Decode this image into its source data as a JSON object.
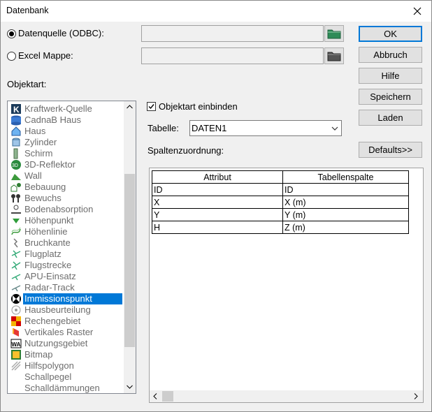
{
  "window": {
    "title": "Datenbank",
    "close_glyph": "✕"
  },
  "source": {
    "odbc_label": "Datenquelle (ODBC):",
    "odbc_value": "",
    "excel_label": "Excel Mappe:",
    "excel_value": ""
  },
  "object_type_label": "Objektart:",
  "object_types": [
    {
      "label": "Kraftwerk-Quelle",
      "icon": "power-plant-icon"
    },
    {
      "label": "CadnaB Haus",
      "icon": "house-db-icon"
    },
    {
      "label": "Haus",
      "icon": "house-icon"
    },
    {
      "label": "Zylinder",
      "icon": "cylinder-icon"
    },
    {
      "label": "Schirm",
      "icon": "screen-icon"
    },
    {
      "label": "3D-Reflektor",
      "icon": "3d-reflector-icon"
    },
    {
      "label": "Wall",
      "icon": "wall-icon"
    },
    {
      "label": "Bebauung",
      "icon": "buildings-icon"
    },
    {
      "label": "Bewuchs",
      "icon": "vegetation-icon"
    },
    {
      "label": "Bodenabsorption",
      "icon": "ground-absorption-icon"
    },
    {
      "label": "Höhenpunkt",
      "icon": "height-point-icon"
    },
    {
      "label": "Höhenlinie",
      "icon": "contour-line-icon"
    },
    {
      "label": "Bruchkante",
      "icon": "break-line-icon"
    },
    {
      "label": "Flugplatz",
      "icon": "airfield-icon"
    },
    {
      "label": "Flugstrecke",
      "icon": "flight-route-icon"
    },
    {
      "label": "APU-Einsatz",
      "icon": "apu-icon"
    },
    {
      "label": "Radar-Track",
      "icon": "radar-track-icon"
    },
    {
      "label": "Immissionspunkt",
      "icon": "receiver-point-icon",
      "selected": true
    },
    {
      "label": "Hausbeurteilung",
      "icon": "house-assessment-icon"
    },
    {
      "label": "Rechengebiet",
      "icon": "calc-area-icon"
    },
    {
      "label": "Vertikales Raster",
      "icon": "vertical-grid-icon"
    },
    {
      "label": "Nutzungsgebiet",
      "icon": "land-use-icon"
    },
    {
      "label": "Bitmap",
      "icon": "bitmap-icon"
    },
    {
      "label": "Hilfspolygon",
      "icon": "aux-polygon-icon"
    },
    {
      "label": "Schallpegel",
      "icon": ""
    },
    {
      "label": "Schalldämmungen",
      "icon": ""
    }
  ],
  "include_checkbox_label": "Objektart einbinden",
  "include_checked": true,
  "table_label": "Tabelle:",
  "table_value": "DATEN1",
  "column_mapping_label": "Spaltenzuordnung:",
  "buttons": {
    "ok": "OK",
    "cancel": "Abbruch",
    "help": "Hilfe",
    "save": "Speichern",
    "load": "Laden",
    "defaults": "Defaults>>"
  },
  "grid": {
    "headers": [
      "Attribut",
      "Tabellenspalte"
    ],
    "rows": [
      [
        "ID",
        "ID"
      ],
      [
        "X",
        "X (m)"
      ],
      [
        "Y",
        "Y (m)"
      ],
      [
        "H",
        "Z (m)"
      ]
    ]
  }
}
